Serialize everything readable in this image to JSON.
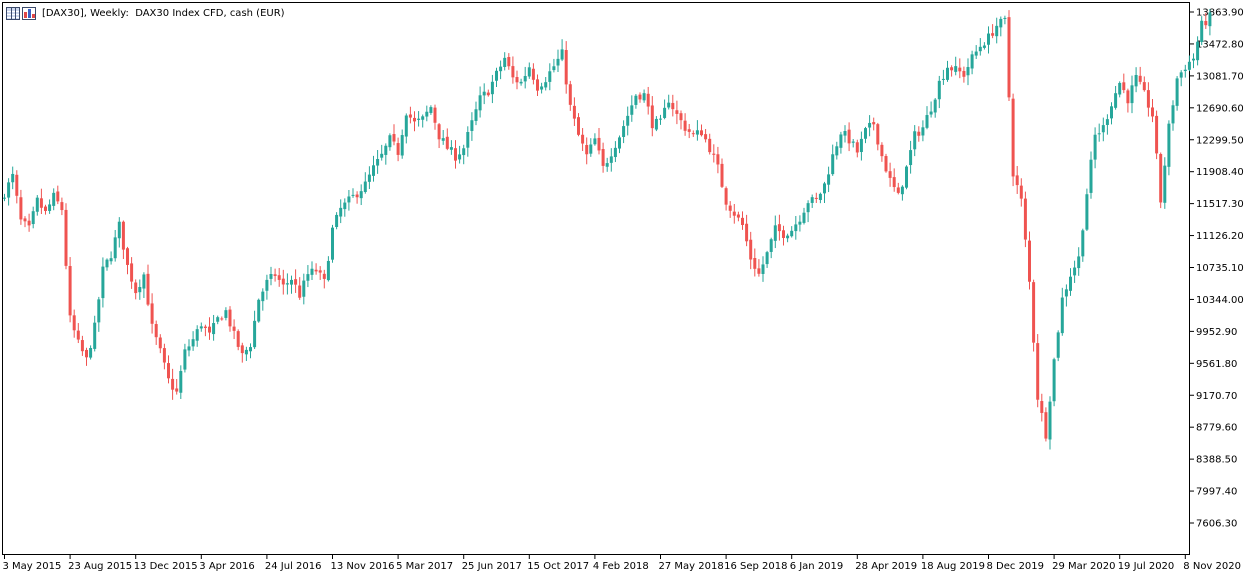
{
  "window": {
    "title": "[DAX30], Weekly:  DAX30 Index CFD, cash (EUR)",
    "icons": [
      "grid-icon",
      "bar-chart-icon"
    ]
  },
  "colors": {
    "bull": "#26a69a",
    "bear": "#ef5350",
    "axis": "#000000",
    "background": "#ffffff"
  },
  "chart_data": {
    "type": "candlestick",
    "symbol": "DAX30",
    "timeframe": "Weekly",
    "y_ticks": [
      "13863.90",
      "13472.80",
      "13081.70",
      "12690.60",
      "12299.50",
      "11908.40",
      "11517.30",
      "11126.20",
      "10735.10",
      "10344.00",
      "9952.90",
      "9561.80",
      "9170.70",
      "8779.60",
      "8388.50",
      "7997.40",
      "7606.30"
    ],
    "ylim": [
      7250,
      13985
    ],
    "x_ticks": [
      "3 May 2015",
      "23 Aug 2015",
      "13 Dec 2015",
      "3 Apr 2016",
      "24 Jul 2016",
      "13 Nov 2016",
      "5 Mar 2017",
      "25 Jun 2017",
      "15 Oct 2017",
      "4 Feb 2018",
      "27 May 2018",
      "16 Sep 2018",
      "6 Jan 2019",
      "28 Apr 2019",
      "18 Aug 2019",
      "8 Dec 2019",
      "29 Mar 2020",
      "19 Jul 2020",
      "8 Nov 2020"
    ],
    "x_tick_index": [
      0,
      16,
      32,
      48,
      64,
      80,
      96,
      112,
      128,
      144,
      160,
      176,
      192,
      208,
      224,
      240,
      256,
      272,
      288
    ],
    "anchors": [
      [
        0,
        11650
      ],
      [
        2,
        11850
      ],
      [
        4,
        11300
      ],
      [
        6,
        11200
      ],
      [
        8,
        11550
      ],
      [
        10,
        11400
      ],
      [
        12,
        11600
      ],
      [
        14,
        11450
      ],
      [
        16,
        10100
      ],
      [
        18,
        9800
      ],
      [
        20,
        9600
      ],
      [
        22,
        10000
      ],
      [
        24,
        10700
      ],
      [
        26,
        10900
      ],
      [
        28,
        11250
      ],
      [
        30,
        10750
      ],
      [
        32,
        10450
      ],
      [
        34,
        10650
      ],
      [
        36,
        10000
      ],
      [
        38,
        9700
      ],
      [
        40,
        9350
      ],
      [
        42,
        9200
      ],
      [
        44,
        9700
      ],
      [
        46,
        9850
      ],
      [
        48,
        10050
      ],
      [
        50,
        9900
      ],
      [
        52,
        10100
      ],
      [
        54,
        10200
      ],
      [
        56,
        9900
      ],
      [
        58,
        9650
      ],
      [
        60,
        9800
      ],
      [
        62,
        10350
      ],
      [
        64,
        10550
      ],
      [
        66,
        10650
      ],
      [
        68,
        10500
      ],
      [
        70,
        10600
      ],
      [
        72,
        10400
      ],
      [
        74,
        10650
      ],
      [
        76,
        10700
      ],
      [
        78,
        10550
      ],
      [
        80,
        11200
      ],
      [
        82,
        11450
      ],
      [
        84,
        11550
      ],
      [
        86,
        11650
      ],
      [
        88,
        11750
      ],
      [
        90,
        11950
      ],
      [
        92,
        12100
      ],
      [
        94,
        12300
      ],
      [
        96,
        12150
      ],
      [
        98,
        12650
      ],
      [
        100,
        12500
      ],
      [
        102,
        12550
      ],
      [
        104,
        12700
      ],
      [
        106,
        12350
      ],
      [
        108,
        12200
      ],
      [
        110,
        12100
      ],
      [
        112,
        12200
      ],
      [
        114,
        12500
      ],
      [
        116,
        12800
      ],
      [
        118,
        12900
      ],
      [
        120,
        13100
      ],
      [
        122,
        13300
      ],
      [
        124,
        13050
      ],
      [
        126,
        13000
      ],
      [
        128,
        13200
      ],
      [
        130,
        12950
      ],
      [
        132,
        13050
      ],
      [
        134,
        13200
      ],
      [
        136,
        13350
      ],
      [
        138,
        12700
      ],
      [
        140,
        12350
      ],
      [
        142,
        12100
      ],
      [
        144,
        12300
      ],
      [
        146,
        11950
      ],
      [
        148,
        12150
      ],
      [
        150,
        12350
      ],
      [
        152,
        12600
      ],
      [
        154,
        12850
      ],
      [
        156,
        12850
      ],
      [
        158,
        12500
      ],
      [
        160,
        12500
      ],
      [
        162,
        12800
      ],
      [
        164,
        12600
      ],
      [
        166,
        12450
      ],
      [
        168,
        12350
      ],
      [
        170,
        12400
      ],
      [
        172,
        12200
      ],
      [
        174,
        11950
      ],
      [
        176,
        11550
      ],
      [
        178,
        11400
      ],
      [
        180,
        11250
      ],
      [
        182,
        10850
      ],
      [
        184,
        10650
      ],
      [
        186,
        10900
      ],
      [
        188,
        11200
      ],
      [
        190,
        11150
      ],
      [
        192,
        11200
      ],
      [
        194,
        11350
      ],
      [
        196,
        11550
      ],
      [
        198,
        11550
      ],
      [
        200,
        11750
      ],
      [
        202,
        12100
      ],
      [
        204,
        12400
      ],
      [
        206,
        12300
      ],
      [
        208,
        12150
      ],
      [
        210,
        12400
      ],
      [
        212,
        12500
      ],
      [
        214,
        12100
      ],
      [
        216,
        11800
      ],
      [
        218,
        11600
      ],
      [
        220,
        11950
      ],
      [
        222,
        12350
      ],
      [
        224,
        12450
      ],
      [
        226,
        12700
      ],
      [
        228,
        13000
      ],
      [
        230,
        13200
      ],
      [
        232,
        13150
      ],
      [
        234,
        13100
      ],
      [
        236,
        13300
      ],
      [
        238,
        13450
      ],
      [
        240,
        13550
      ],
      [
        242,
        13700
      ],
      [
        244,
        13750
      ],
      [
        246,
        11900
      ],
      [
        248,
        11550
      ],
      [
        250,
        10550
      ],
      [
        252,
        9150
      ],
      [
        254,
        8700
      ],
      [
        256,
        9600
      ],
      [
        258,
        10350
      ],
      [
        260,
        10650
      ],
      [
        262,
        10850
      ],
      [
        264,
        11650
      ],
      [
        266,
        12350
      ],
      [
        268,
        12450
      ],
      [
        270,
        12750
      ],
      [
        272,
        13000
      ],
      [
        274,
        12800
      ],
      [
        276,
        13050
      ],
      [
        278,
        12850
      ],
      [
        280,
        12600
      ],
      [
        282,
        11550
      ],
      [
        284,
        12450
      ],
      [
        286,
        13050
      ],
      [
        288,
        13200
      ],
      [
        290,
        13300
      ],
      [
        292,
        13700
      ],
      [
        294,
        13800
      ]
    ]
  }
}
